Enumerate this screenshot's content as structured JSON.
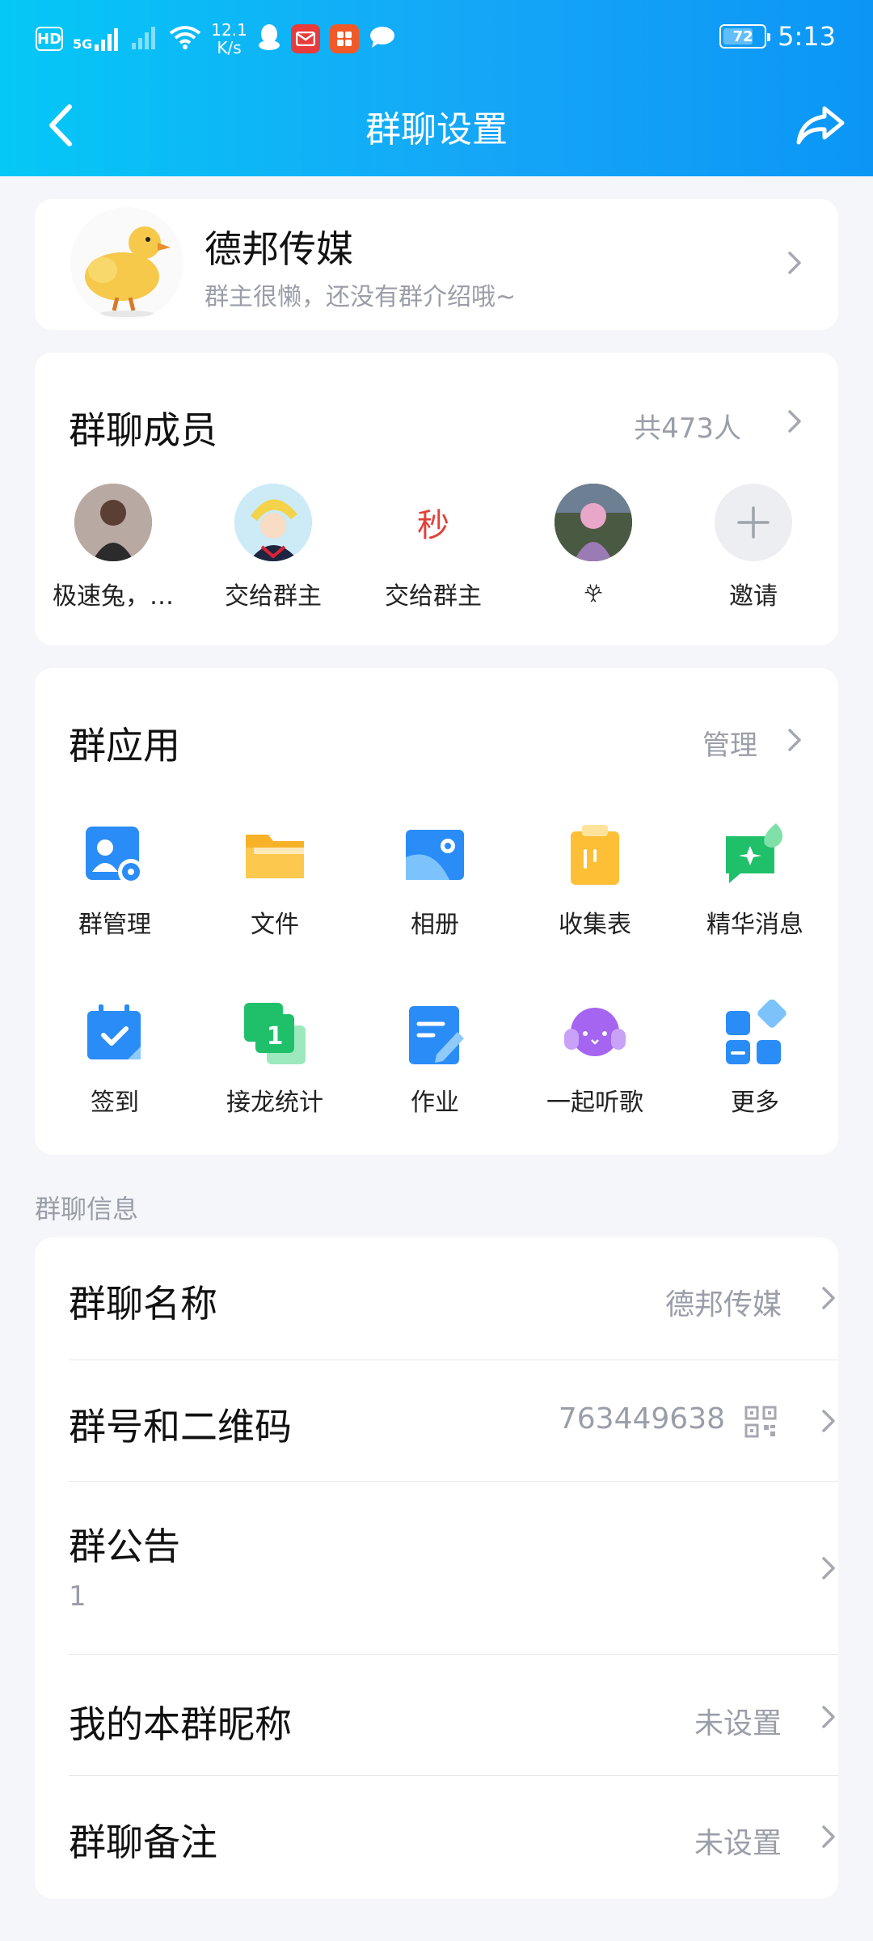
{
  "status_bar": {
    "hd": "HD",
    "sig_5g": "5G",
    "net_speed_top": "12.1",
    "net_speed_bottom": "K/s",
    "battery": "72",
    "battery_level": 0.72,
    "time": "5:13"
  },
  "header": {
    "title": "群聊设置"
  },
  "group": {
    "name": "德邦传媒",
    "description": "群主很懒，还没有群介绍哦~"
  },
  "members": {
    "title": "群聊成员",
    "count": "共473人",
    "list": [
      {
        "name": "极速兔，…"
      },
      {
        "name": "交给群主"
      },
      {
        "name": "交给群主",
        "avatar_text": "秒"
      },
      {
        "name": "𖣂"
      },
      {
        "name": "邀请"
      }
    ]
  },
  "apps": {
    "title": "群应用",
    "manage": "管理",
    "items": [
      {
        "label": "群管理"
      },
      {
        "label": "文件"
      },
      {
        "label": "相册"
      },
      {
        "label": "收集表"
      },
      {
        "label": "精华消息"
      },
      {
        "label": "签到"
      },
      {
        "label": "接龙统计",
        "badge": "1"
      },
      {
        "label": "作业"
      },
      {
        "label": "一起听歌"
      },
      {
        "label": "更多"
      }
    ]
  },
  "info": {
    "section_label": "群聊信息",
    "rows": [
      {
        "title": "群聊名称",
        "value": "德邦传媒"
      },
      {
        "title": "群号和二维码",
        "value": "763449638"
      },
      {
        "title": "群公告",
        "value": "1"
      },
      {
        "title": "我的本群昵称",
        "value": "未设置"
      },
      {
        "title": "群聊备注",
        "value": "未设置"
      }
    ]
  },
  "colors": {
    "header_start": "#05c8f6",
    "header_end": "#0b96f6",
    "accent_blue": "#1e90f5",
    "folder_yellow": "#fbbf3c",
    "green": "#21c36b",
    "purple": "#a565f0"
  }
}
